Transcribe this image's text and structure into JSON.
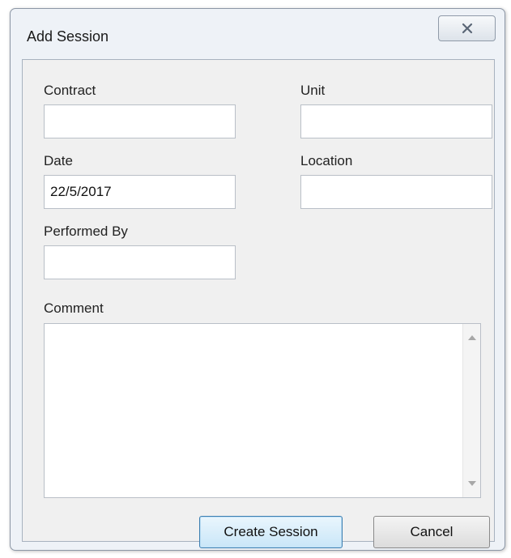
{
  "window": {
    "title": "Add Session",
    "close_icon": "close-x-icon"
  },
  "form": {
    "contract": {
      "label": "Contract",
      "value": ""
    },
    "unit": {
      "label": "Unit",
      "value": ""
    },
    "date": {
      "label": "Date",
      "value": "22/5/2017"
    },
    "location": {
      "label": "Location",
      "value": ""
    },
    "performed_by": {
      "label": "Performed By",
      "value": ""
    },
    "comment": {
      "label": "Comment",
      "value": ""
    }
  },
  "buttons": {
    "create_label": "Create Session",
    "cancel_label": "Cancel"
  },
  "colors": {
    "default_button_border": "#3c7fb1",
    "window_frame": "#eef2f7"
  }
}
